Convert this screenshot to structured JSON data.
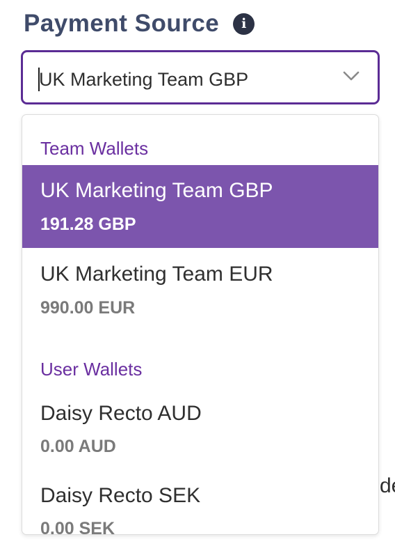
{
  "field": {
    "label": "Payment Source",
    "info_icon": "info-icon",
    "selected_value": "UK Marketing Team GBP",
    "chevron_icon": "chevron-down-icon"
  },
  "dropdown": {
    "groups": [
      {
        "header": "Team Wallets",
        "options": [
          {
            "name": "UK Marketing Team GBP",
            "balance": "191.28 GBP",
            "selected": true
          },
          {
            "name": "UK Marketing Team EUR",
            "balance": "990.00 EUR",
            "selected": false
          }
        ]
      },
      {
        "header": "User Wallets",
        "options": [
          {
            "name": "Daisy Recto AUD",
            "balance": "0.00 AUD",
            "selected": false
          },
          {
            "name": "Daisy Recto SEK",
            "balance": "0.00 SEK",
            "selected": false
          }
        ]
      }
    ]
  },
  "background": {
    "partial_text": "de"
  },
  "colors": {
    "label": "#3f4b6a",
    "accent_border": "#5b2c94",
    "group_header": "#6a2fa0",
    "selected_bg": "#7c55ad",
    "balance_text": "#7a7a7a"
  }
}
